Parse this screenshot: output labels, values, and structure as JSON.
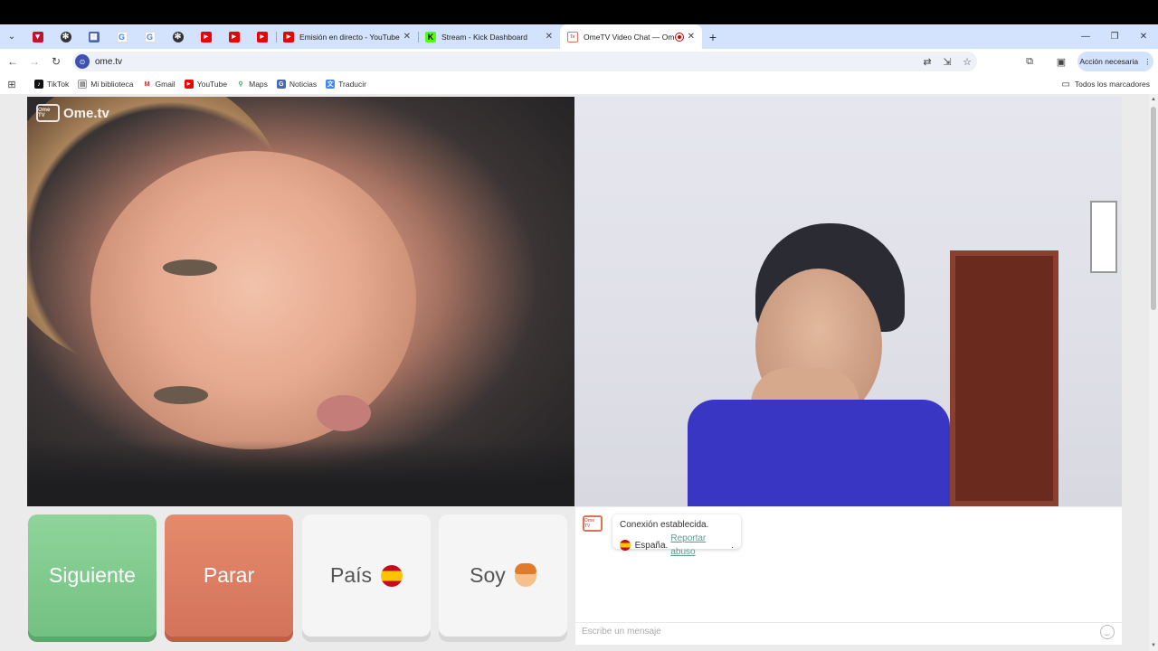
{
  "browser": {
    "tabs": [
      {
        "title": "Emisión en directo - YouTube S",
        "favicon": "youtube-icon"
      },
      {
        "title": "Stream - Kick Dashboard",
        "favicon": "kick-icon"
      },
      {
        "title": "OmeTV Video Chat — Ome",
        "favicon": "ometv-icon",
        "active": true
      }
    ],
    "pinned_favicons": [
      "todoist-icon",
      "openai-icon",
      "grid-icon",
      "google-icon",
      "google-icon",
      "openai-icon",
      "youtube-icon",
      "youtube-icon",
      "youtube-icon"
    ],
    "url": "ome.tv",
    "action_button": "Acción necesaria",
    "bookmarks": [
      {
        "label": "TikTok",
        "icon": "tiktok-icon"
      },
      {
        "label": "Mi biblioteca",
        "icon": "library-icon"
      },
      {
        "label": "Gmail",
        "icon": "gmail-icon"
      },
      {
        "label": "YouTube",
        "icon": "youtube-icon"
      },
      {
        "label": "Maps",
        "icon": "maps-icon"
      },
      {
        "label": "Noticias",
        "icon": "news-icon"
      },
      {
        "label": "Traducir",
        "icon": "translate-icon"
      }
    ],
    "all_bookmarks": "Todos los marcadores"
  },
  "ometv": {
    "logo": "Ome.tv",
    "logo_badge": "Ome TV",
    "buttons": {
      "next": "Siguiente",
      "stop": "Parar",
      "country": "País",
      "soy": "Soy"
    },
    "chat": {
      "status": "Conexión establecida.",
      "country": "España.",
      "report": "Reportar abuso",
      "report_suffix": ".",
      "placeholder": "Escribe un mensaje"
    },
    "colors": {
      "next": "#7dc98c",
      "stop": "#dc7c62",
      "accent_link": "#5c9c8c"
    }
  }
}
